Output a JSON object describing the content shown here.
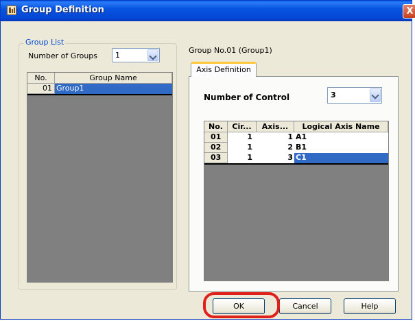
{
  "window": {
    "title": "Group Definition",
    "close_glyph": "X"
  },
  "group_list": {
    "legend": "Group List",
    "count_label": "Number of Groups",
    "count_value": "1",
    "table": {
      "headers": [
        "No.",
        "Group Name"
      ],
      "rows": [
        {
          "no": "01",
          "name": "Group1"
        }
      ]
    }
  },
  "group_title": "Group No.01 (Group1)",
  "tabs": [
    {
      "label": "Axis Definition"
    }
  ],
  "axis": {
    "control_label": "Number of Control",
    "control_value": "3",
    "table": {
      "headers": [
        "No.",
        "Cir...",
        "Axis...",
        "Logical Axis Name"
      ],
      "rows": [
        {
          "no": "01",
          "cir": "1",
          "axis": "1",
          "name": "A1"
        },
        {
          "no": "02",
          "cir": "1",
          "axis": "2",
          "name": "B1"
        },
        {
          "no": "03",
          "cir": "1",
          "axis": "3",
          "name": "C1"
        }
      ]
    }
  },
  "buttons": {
    "ok": "OK",
    "cancel": "Cancel",
    "help": "Help"
  },
  "colors": {
    "titlebar": "#0753e0",
    "selection": "#316ac5",
    "highlight_ring": "#e0201a",
    "tab_accent": "#ffc83c"
  }
}
